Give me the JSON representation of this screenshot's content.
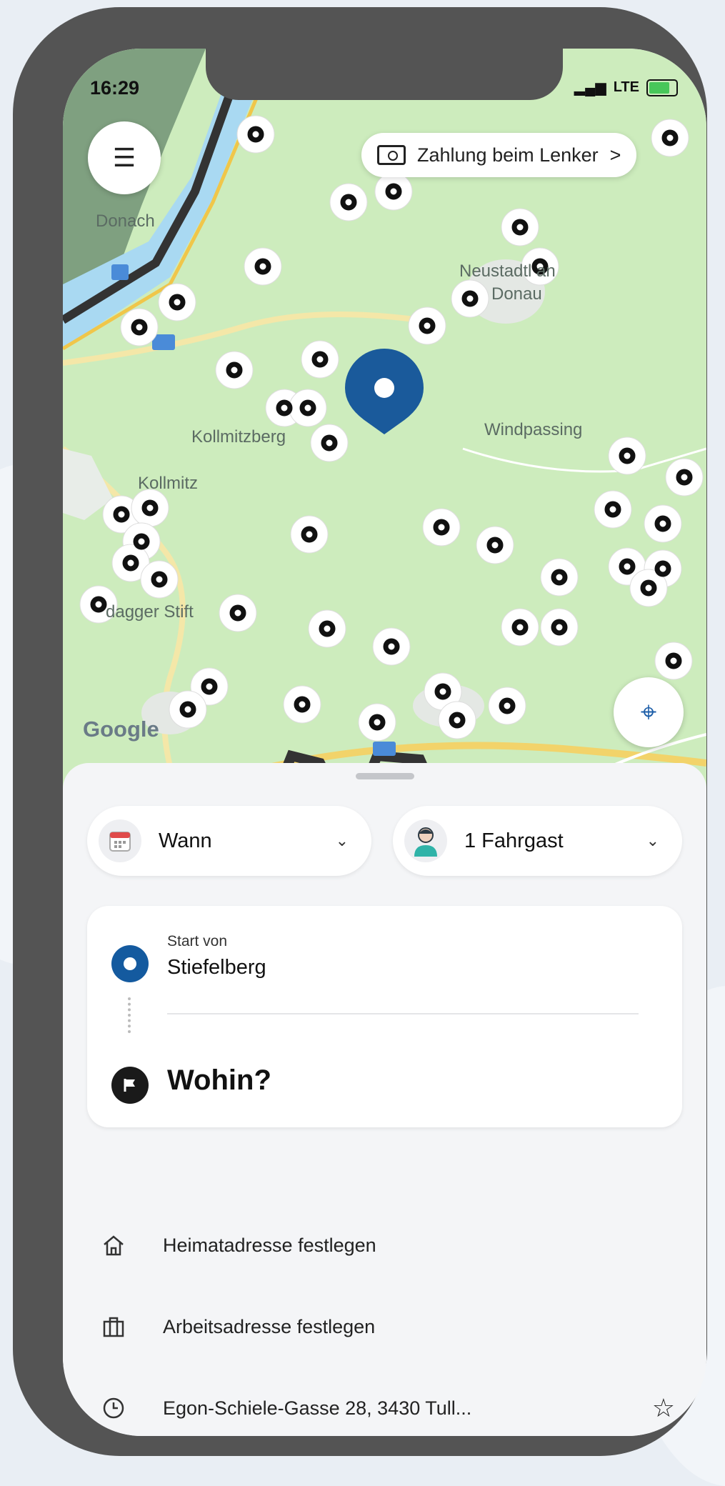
{
  "status_bar": {
    "time": "16:29",
    "signal": "LTE"
  },
  "map": {
    "labels": {
      "donau": "Donach",
      "neustadtl": "Neustadtl an",
      "donau2": "Donau",
      "kollmitzberg": "Kollmitzberg",
      "windpassing": "Windpassing",
      "kollmitz": "Kollmitz",
      "ardagger": "dagger Stift",
      "google": "Google"
    },
    "payment_label": "Zahlung beim Lenker",
    "payment_chevron": ">",
    "pin_color": "#1a5a9b",
    "map_color": "#cdecbd"
  },
  "sheet": {
    "when_label": "Wann",
    "passengers_label": "1 Fahrgast",
    "start_caption": "Start von",
    "start_name": "Stiefelberg",
    "destination_placeholder": "Wohin?",
    "saved": [
      {
        "icon": "home-icon",
        "label": "Heimatadresse festlegen"
      },
      {
        "icon": "briefcase-icon",
        "label": "Arbeitsadresse festlegen"
      },
      {
        "icon": "clock-icon",
        "label": "Egon-Schiele-Gasse 28, 3430 Tull..."
      }
    ]
  }
}
